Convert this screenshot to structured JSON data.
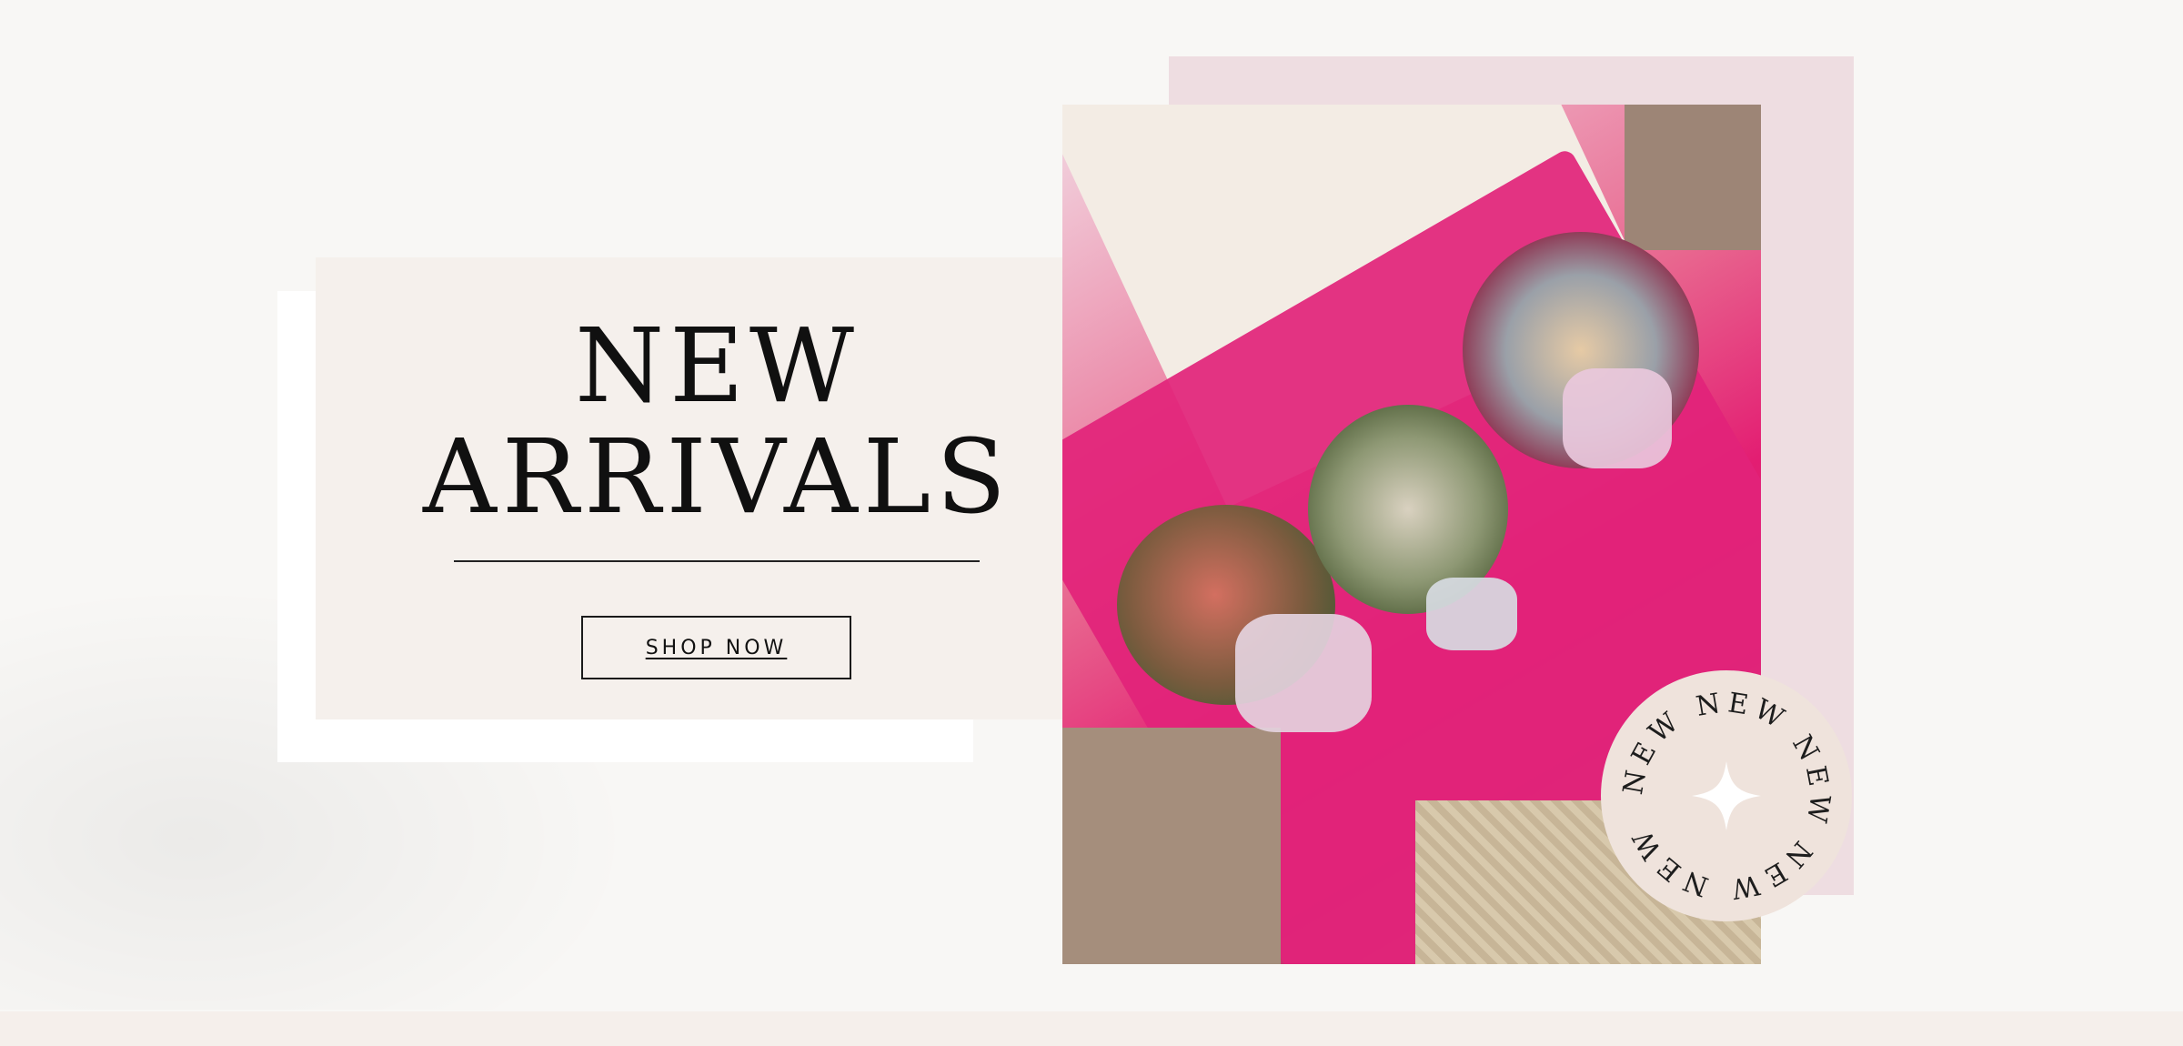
{
  "hero": {
    "headline_line1": "NEW",
    "headline_line2": "ARRIVALS",
    "cta_label": "SHOP NOW"
  },
  "badge": {
    "ring_text": "NEW NEW NEW NEW NEW",
    "center_icon": "sparkle-star-icon"
  },
  "colors": {
    "card_background": "#f5f0ec",
    "text": "#101010",
    "accent_pink": "#e31d72",
    "badge_background": "#efe3dc"
  }
}
